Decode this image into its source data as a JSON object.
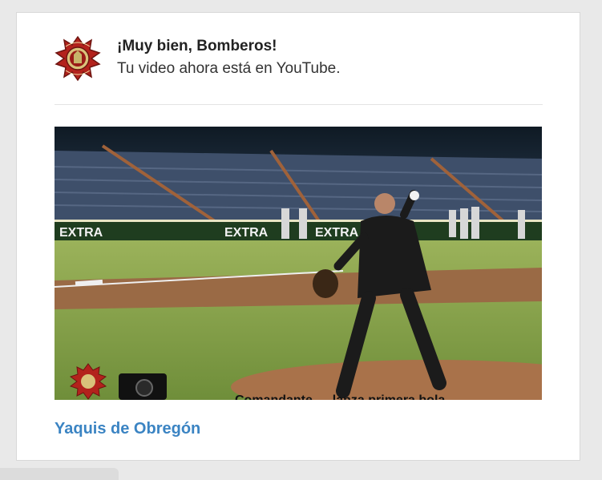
{
  "notification": {
    "title": "¡Muy bien, Bomberos!",
    "message": "Tu video ahora está en YouTube."
  },
  "avatar": {
    "icon": "fire-department-badge-icon",
    "color": "#b3221c"
  },
  "video": {
    "title": "Yaquis de Obregón",
    "caption_overlay": "Comandante … lanza primera bola",
    "banner_text": [
      "EXTRA",
      "EXTRA",
      "EXTRA"
    ],
    "link_color": "#3b84c3"
  }
}
